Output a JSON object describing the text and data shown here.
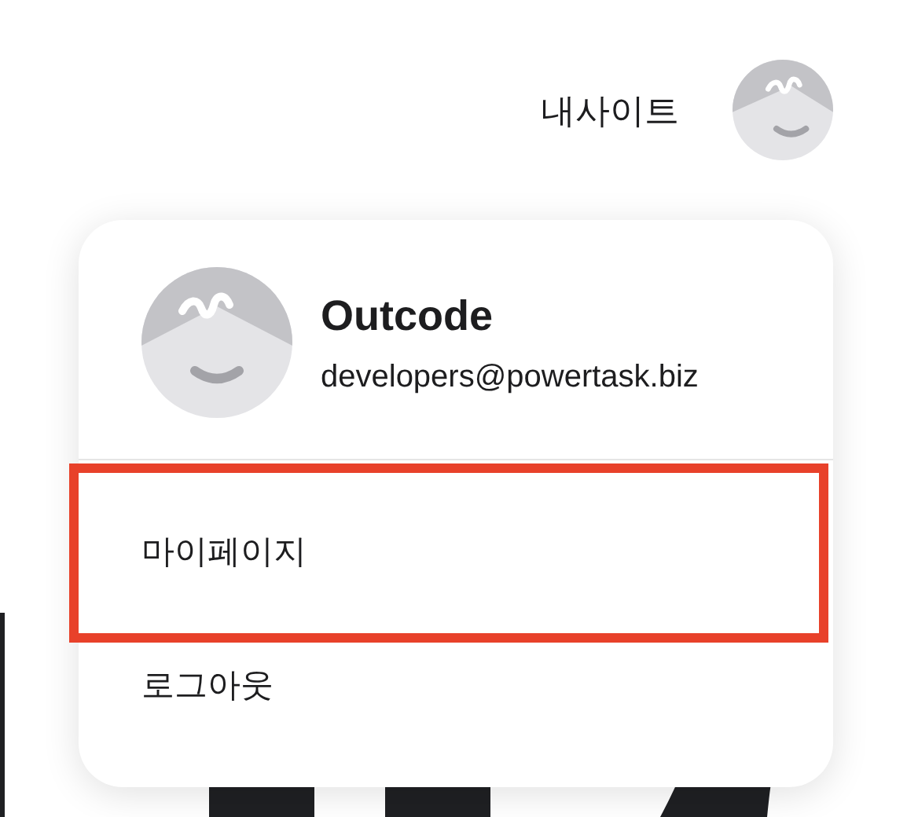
{
  "header": {
    "site_link": "내사이트"
  },
  "profile": {
    "name": "Outcode",
    "email": "developers@powertask.biz"
  },
  "menu": [
    {
      "label": "마이페이지",
      "highlighted": true
    },
    {
      "label": "로그아웃",
      "highlighted": false
    }
  ]
}
